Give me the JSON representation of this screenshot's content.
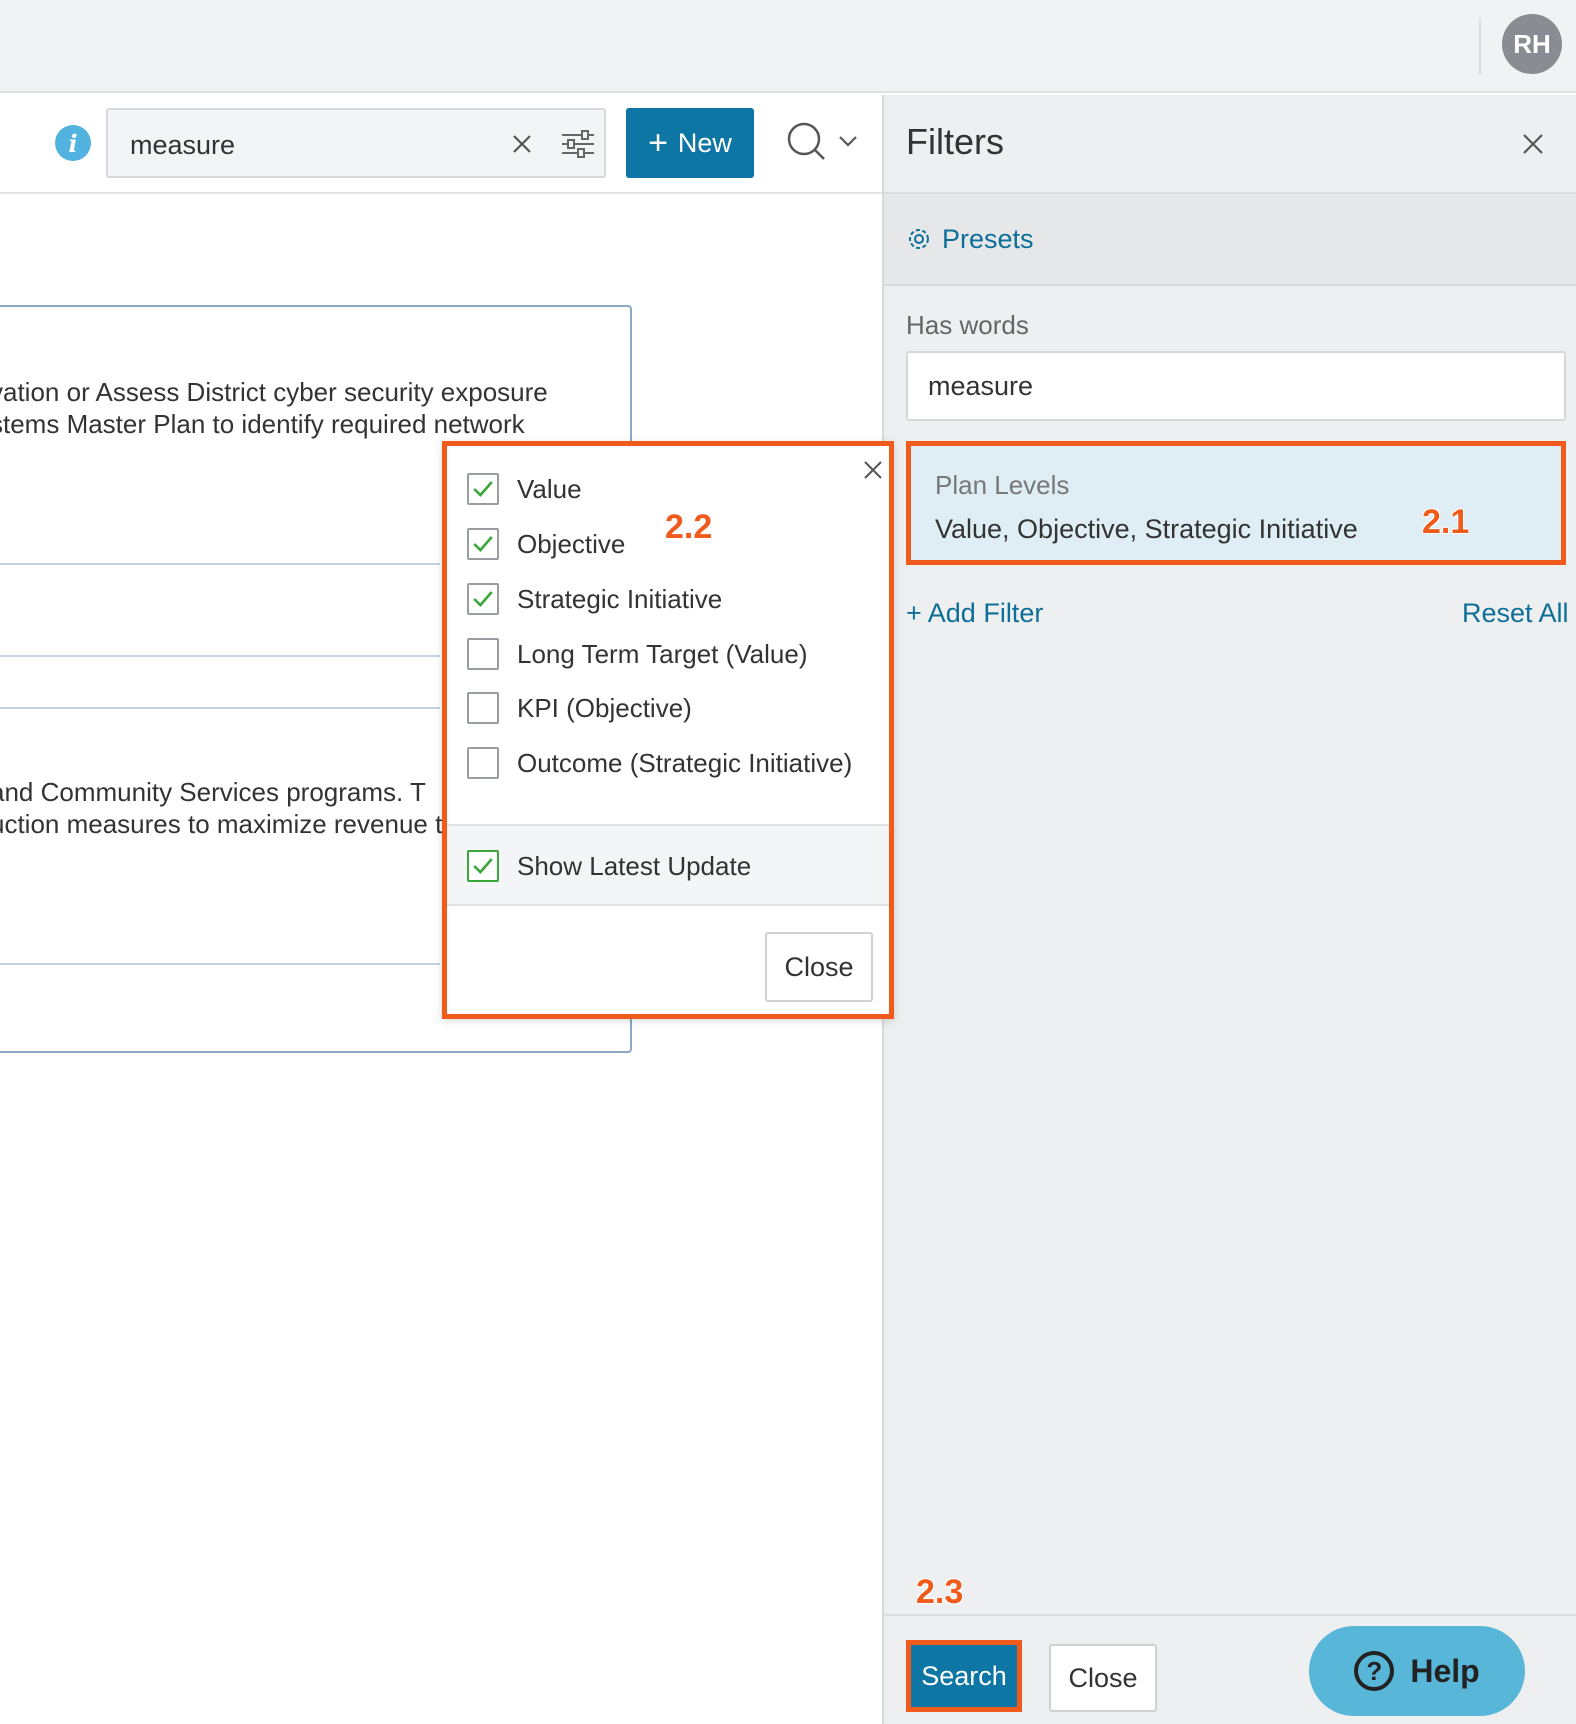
{
  "user": {
    "initials": "RH"
  },
  "toolbar": {
    "search_value": "measure",
    "new_label": "New"
  },
  "results": {
    "lines": [
      "vation or Assess District cyber security exposure",
      "stems Master Plan to identify required network",
      " and Community Services programs. T",
      "uction measures to maximize revenue t"
    ]
  },
  "filters": {
    "title": "Filters",
    "presets_label": "Presets",
    "has_words_label": "Has words",
    "has_words_value": "measure",
    "plan_levels_title": "Plan Levels",
    "plan_levels_value": "Value, Objective, Strategic Initiative",
    "add_filter_label": "+ Add Filter",
    "reset_all_label": "Reset All",
    "search_label": "Search",
    "close_label": "Close",
    "help_label": "Help"
  },
  "popup": {
    "options": [
      {
        "label": "Value",
        "checked": true
      },
      {
        "label": "Objective",
        "checked": true
      },
      {
        "label": "Strategic Initiative",
        "checked": true
      },
      {
        "label": "Long Term Target (Value)",
        "checked": false
      },
      {
        "label": "KPI (Objective)",
        "checked": false
      },
      {
        "label": "Outcome (Strategic Initiative)",
        "checked": false
      }
    ],
    "show_latest_label": "Show Latest Update",
    "show_latest_checked": true,
    "close_label": "Close"
  },
  "annotations": {
    "a1": "2.1",
    "a2": "2.2",
    "a3": "2.3"
  },
  "colors": {
    "accent": "#0d76a4",
    "highlight": "#f05a1a",
    "check": "#3aa63a"
  }
}
